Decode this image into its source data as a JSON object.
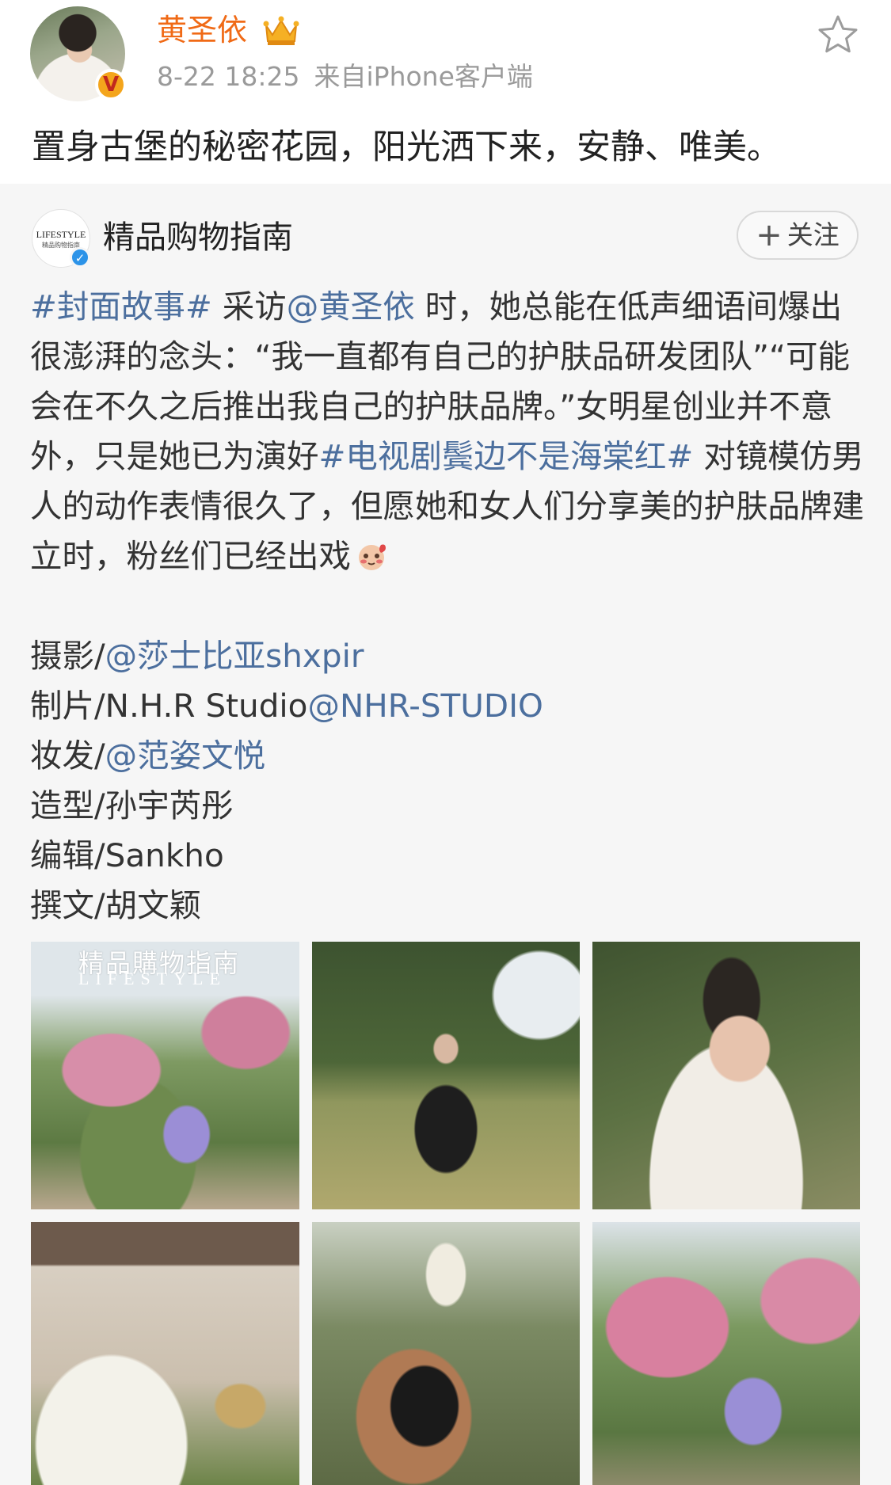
{
  "post": {
    "author": "黄圣依",
    "time": "8-22 18:25",
    "source": "来自iPhone客户端",
    "text": "置身古堡的秘密花园，阳光洒下来，安静、唯美。"
  },
  "repost": {
    "author": "精品购物指南",
    "avatar_text": "LIFESTYLE",
    "avatar_subtext": "精品购物指南",
    "follow_label": "关注",
    "follow_plus": "+",
    "paragraph": [
      {
        "type": "tag",
        "text": "#封面故事#"
      },
      {
        "type": "text",
        "text": " 采访"
      },
      {
        "type": "mention",
        "text": "@黄圣依"
      },
      {
        "type": "text",
        "text": " 时，她总能在低声细语间爆出很澎湃的念头：“我一直都有自己的护肤品研发团队”“可能会在不久之后推出我自己的护肤品牌。”女明星创业并不意外，只是她已为演好"
      },
      {
        "type": "tag",
        "text": "#电视剧鬓边不是海棠红#"
      },
      {
        "type": "text",
        "text": " 对镜模仿男人的动作表情很久了，但愿她和女人们分享美的护肤品牌建立时，粉丝们已经出戏"
      }
    ],
    "credits": [
      {
        "label": "摄影/",
        "mention": "@莎士比亚shxpir"
      },
      {
        "label": "制片/N.H.R Studio",
        "mention": "@NHR-STUDIO"
      },
      {
        "label": "妆发/",
        "mention": "@范姿文悦"
      },
      {
        "label": "造型/孙宇芮彤",
        "mention": ""
      },
      {
        "label": "编辑/Sankho",
        "mention": ""
      },
      {
        "label": "撰文/胡文颖",
        "mention": ""
      }
    ],
    "cover_title": "精品購物指南",
    "cover_subtitle": "LIFESTYLE"
  },
  "colors": {
    "username": "#f06a16",
    "link": "#4c6f9e",
    "meta": "#9a9a9a",
    "repost_bg": "#f6f6f6"
  },
  "icons": {
    "crown": "crown-icon",
    "star": "star-icon",
    "verified": "verified-badge-icon",
    "emoji": "blush-emoji-icon"
  }
}
